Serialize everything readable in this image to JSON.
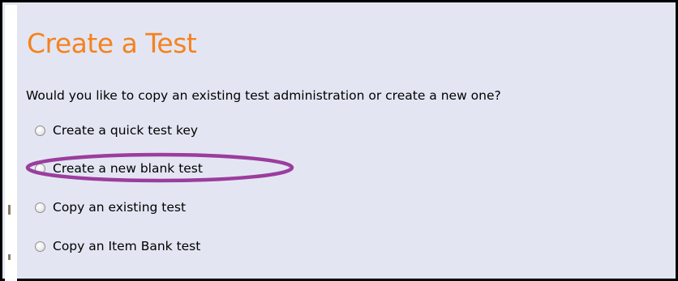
{
  "dialog": {
    "title": "Create a Test",
    "question": "Would you like to copy an existing test administration or create a new one?",
    "options": [
      {
        "label": "Create a quick test key",
        "selected": false
      },
      {
        "label": "Create a new blank test",
        "selected": false,
        "highlighted": true
      },
      {
        "label": "Copy an existing test",
        "selected": false
      },
      {
        "label": "Copy an Item Bank test",
        "selected": false
      }
    ]
  },
  "colors": {
    "title": "#f5821f",
    "background": "#e3e6f2",
    "highlight_ellipse": "#9b3d9e",
    "border": "#000000"
  }
}
